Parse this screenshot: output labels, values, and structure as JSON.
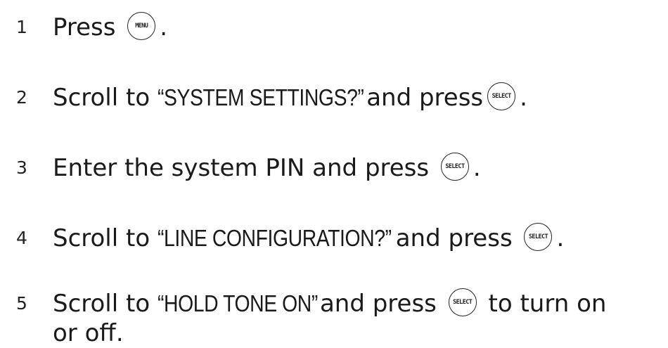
{
  "steps": [
    {
      "number": "1",
      "parts": {
        "a": "Press",
        "key": "MENU",
        "b": "."
      }
    },
    {
      "number": "2",
      "parts": {
        "a": "Scroll to",
        "quoted": "“SYSTEM SETTINGS?”",
        "b": "and press",
        "key": "SELECT",
        "c": "."
      }
    },
    {
      "number": "3",
      "parts": {
        "a": "Enter the system PIN and press",
        "key": "SELECT",
        "b": "."
      }
    },
    {
      "number": "4",
      "parts": {
        "a": "Scroll to",
        "quoted": "“LINE CONFIGURATION?”",
        "b": "and press",
        "key": "SELECT",
        "c": "."
      }
    },
    {
      "number": "5",
      "parts": {
        "a": "Scroll to",
        "quoted": "“HOLD TONE ON”",
        "b": "and press",
        "key": "SELECT",
        "c": "to turn on",
        "d": "or off."
      }
    }
  ]
}
